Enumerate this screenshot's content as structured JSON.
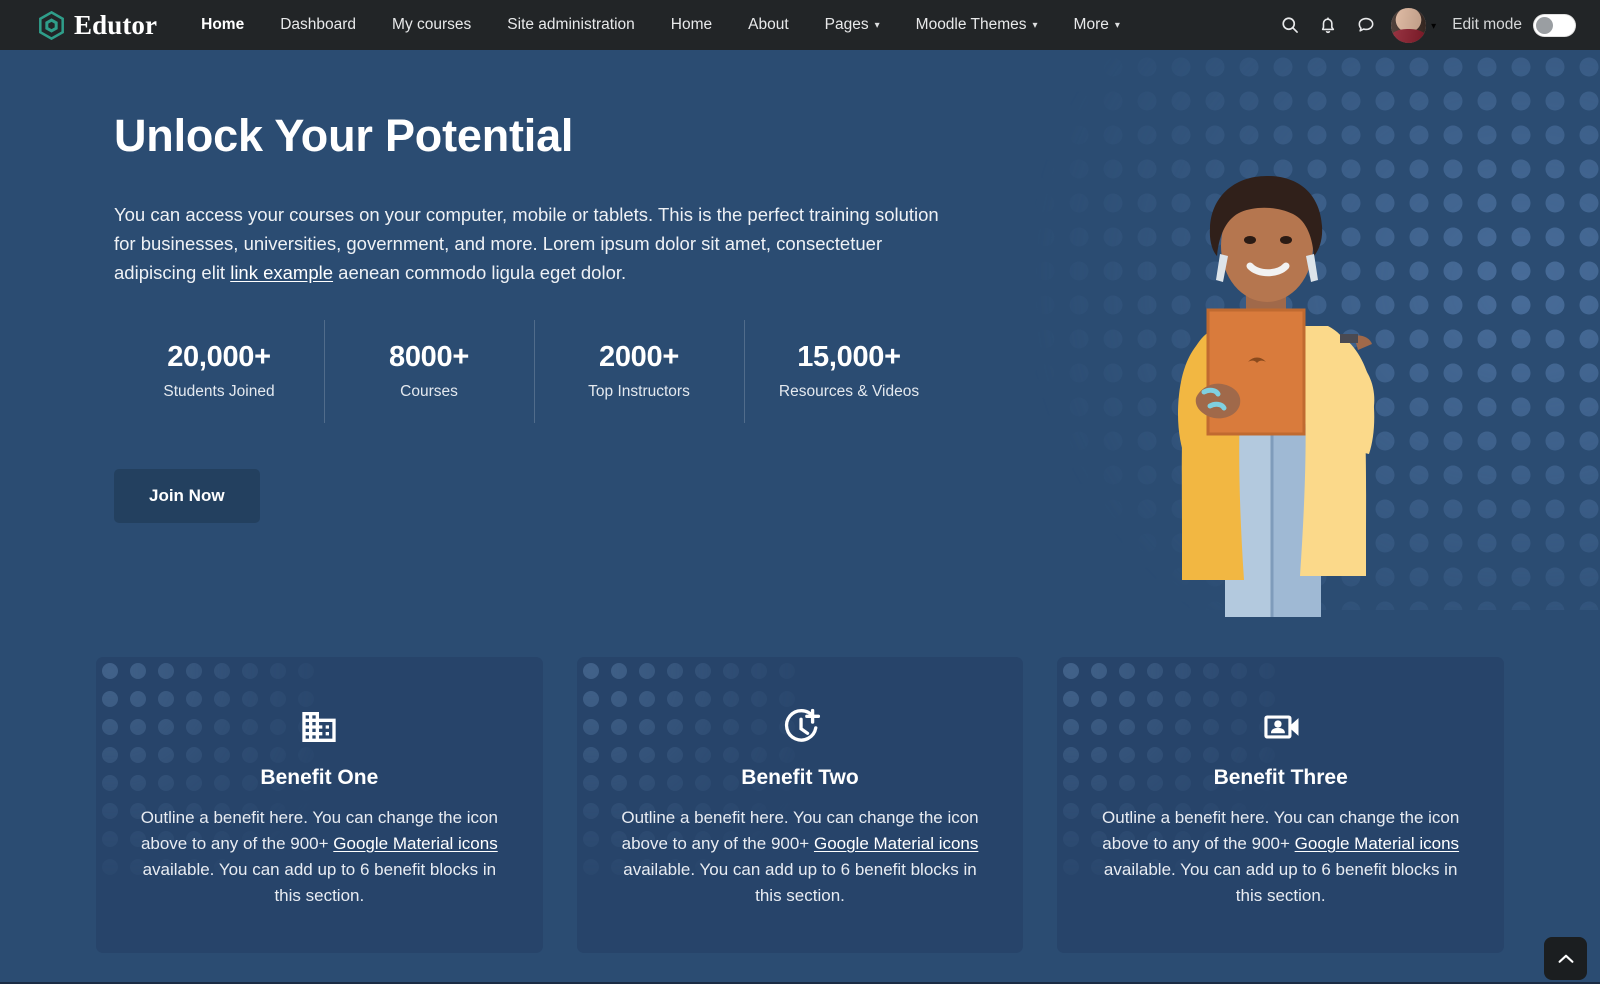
{
  "navbar": {
    "brand": {
      "name": "Edutor",
      "icon": "hexagon-cube-logo-icon",
      "accent": "#2f9e8a"
    },
    "links": [
      {
        "label": "Home",
        "active": true,
        "has_caret": false
      },
      {
        "label": "Dashboard",
        "active": false,
        "has_caret": false
      },
      {
        "label": "My courses",
        "active": false,
        "has_caret": false
      },
      {
        "label": "Site administration",
        "active": false,
        "has_caret": false
      },
      {
        "label": "Home",
        "active": false,
        "has_caret": false
      },
      {
        "label": "About",
        "active": false,
        "has_caret": false
      },
      {
        "label": "Pages",
        "active": false,
        "has_caret": true
      },
      {
        "label": "Moodle Themes",
        "active": false,
        "has_caret": true
      },
      {
        "label": "More",
        "active": false,
        "has_caret": true
      }
    ],
    "icons": [
      {
        "name": "search-icon"
      },
      {
        "name": "bell-notification-icon"
      },
      {
        "name": "chat-bubble-icon"
      }
    ],
    "avatar": {
      "name": "user-avatar",
      "caret": "⌄"
    },
    "edit_mode": {
      "label": "Edit mode",
      "enabled": false
    },
    "background": "#222527"
  },
  "hero": {
    "title": "Unlock Your Potential",
    "paragraph_before": "You can access your courses on your computer, mobile or tablets. This is the perfect training solution for businesses, universities, government, and more. Lorem ipsum dolor sit amet, consectetuer adipiscing elit ",
    "paragraph_link": "link example",
    "paragraph_after": " aenean commodo ligula eget dolor.",
    "stats": [
      {
        "value": "20,000+",
        "label": "Students Joined"
      },
      {
        "value": "8000+",
        "label": "Courses"
      },
      {
        "value": "2000+",
        "label": "Top Instructors"
      },
      {
        "value": "15,000+",
        "label": "Resources & Videos"
      }
    ],
    "cta_label": "Join Now",
    "photo_alt": "smiling-woman-with-tablet-photo",
    "background": "#2b4c72"
  },
  "benefits": [
    {
      "icon": "building-apartment-icon",
      "title": "Benefit One",
      "text_before": "Outline a benefit here. You can change the icon above to any of the 900+ ",
      "text_link": "Google Material icons",
      "text_after": " available. You can add up to 6 benefit blocks in this section."
    },
    {
      "icon": "clock-add-time-icon",
      "title": "Benefit Two",
      "text_before": "Outline a benefit here. You can change the icon above to any of the 900+ ",
      "text_link": "Google Material icons",
      "text_after": " available. You can add up to 6 benefit blocks in this section."
    },
    {
      "icon": "video-camera-front-icon",
      "title": "Benefit Three",
      "text_before": "Outline a benefit here. You can change the icon above to any of the 900+ ",
      "text_link": "Google Material icons",
      "text_after": " available. You can add up to 6 benefit blocks in this section."
    }
  ],
  "scroll_top": {
    "name": "scroll-to-top-button",
    "glyph": "chevron-up-icon"
  }
}
